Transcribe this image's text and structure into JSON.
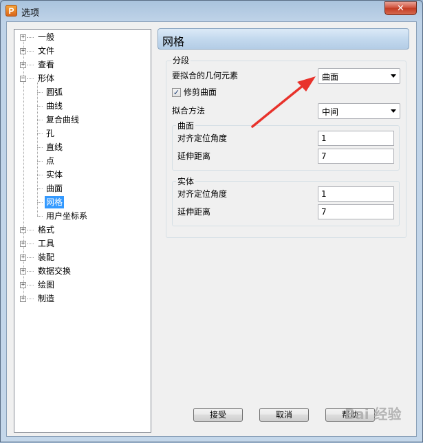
{
  "window": {
    "title": "选项",
    "app_icon": "P",
    "close_glyph": "✕"
  },
  "tree": {
    "items": [
      {
        "label": "一般",
        "expander": "+"
      },
      {
        "label": "文件",
        "expander": "+"
      },
      {
        "label": "查看",
        "expander": "+"
      },
      {
        "label": "形体",
        "expander": "−"
      },
      {
        "label": "圆弧"
      },
      {
        "label": "曲线"
      },
      {
        "label": "复合曲线"
      },
      {
        "label": "孔"
      },
      {
        "label": "直线"
      },
      {
        "label": "点"
      },
      {
        "label": "实体"
      },
      {
        "label": "曲面"
      },
      {
        "label": "网格",
        "selected": true
      },
      {
        "label": "用户坐标系"
      },
      {
        "label": "格式",
        "expander": "+"
      },
      {
        "label": "工具",
        "expander": "+"
      },
      {
        "label": "装配",
        "expander": "+"
      },
      {
        "label": "数据交换",
        "expander": "+"
      },
      {
        "label": "绘图",
        "expander": "+"
      },
      {
        "label": "制造",
        "expander": "+"
      }
    ]
  },
  "panel": {
    "title": "网格",
    "segment_group": {
      "title": "分段",
      "geometry_label": "要拟合的几何元素",
      "geometry_value": "曲面",
      "trim_checkbox_label": "修剪曲面",
      "trim_checked": true,
      "trim_check_glyph": "✓",
      "fit_method_label": "拟合方法",
      "fit_method_value": "中间",
      "surface_group": {
        "title": "曲面",
        "align_angle_label": "对齐定位角度",
        "align_angle_value": "1",
        "extend_distance_label": "延伸距离",
        "extend_distance_value": "7"
      },
      "solid_group": {
        "title": "实体",
        "align_angle_label": "对齐定位角度",
        "align_angle_value": "1",
        "extend_distance_label": "延伸距离",
        "extend_distance_value": "7"
      }
    }
  },
  "buttons": {
    "ok": "接受",
    "cancel": "取消",
    "help": "帮助"
  },
  "annotation": {
    "arrow_color": "#e8322b"
  },
  "watermark": "Bai 经验"
}
